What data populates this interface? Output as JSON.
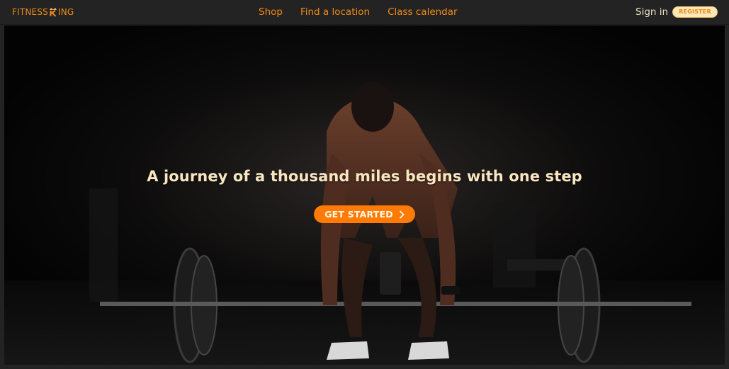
{
  "header": {
    "logo_text_left": "FITNESS",
    "logo_text_right": "ING",
    "logo_icon": "crown-k-icon",
    "nav": [
      {
        "label": "Shop"
      },
      {
        "label": "Find a location"
      },
      {
        "label": "Class calendar"
      }
    ],
    "signin_label": "Sign in",
    "register_label": "REGISTER"
  },
  "hero": {
    "headline": "A journey of a thousand miles begins with one step",
    "cta_label": "GET STARTED",
    "cta_icon": "chevron-right-icon",
    "image_subject": "athlete-deadlift-photo"
  },
  "colors": {
    "accent": "#f08a18",
    "cta": "#ff7b05",
    "headline": "#f7e6c0",
    "topbar": "#232323"
  }
}
